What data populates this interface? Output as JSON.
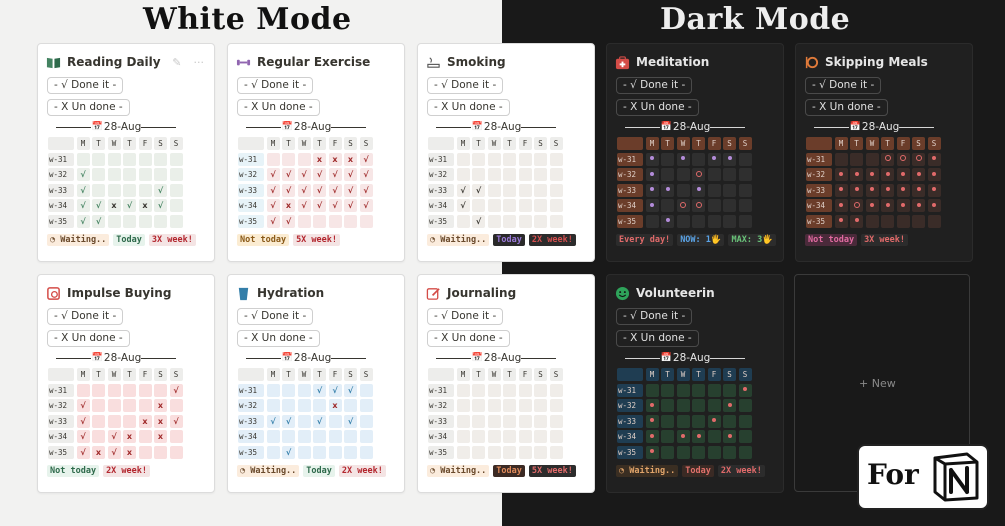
{
  "titles": {
    "white": "White Mode",
    "dark": "Dark Mode"
  },
  "common": {
    "done_label": "- √ Done it -",
    "undone_label": "- X Un done -",
    "date": "28-Aug",
    "days": [
      "M",
      "T",
      "W",
      "T",
      "F",
      "S",
      "S"
    ],
    "weeks": [
      "w-31",
      "w-32",
      "w-33",
      "w-34",
      "w-35"
    ]
  },
  "new_card": {
    "label": "+ New"
  },
  "badge": {
    "text": "For"
  },
  "cards": [
    {
      "id": "reading",
      "name": "Reading Daily",
      "theme": "light",
      "icon": "book-icon",
      "tools": true,
      "colors": {
        "head": "#ededeb",
        "cell": "#eaefe9",
        "ok": "#448361",
        "x": "#37352f"
      },
      "grid": [
        "......",
        "√.....",
        "√...√.",
        "√.x.x√.",
        "√......"
      ],
      "marks": [
        [
          ".",
          ".",
          ".",
          ".",
          ".",
          ".",
          "."
        ],
        [
          "√",
          ".",
          ".",
          ".",
          ".",
          ".",
          "."
        ],
        [
          "√",
          ".",
          ".",
          ".",
          ".",
          "√",
          "."
        ],
        [
          "√",
          "√",
          "x",
          "√",
          "x",
          "√",
          "."
        ],
        [
          "√",
          "√",
          ".",
          ".",
          ".",
          ".",
          "."
        ]
      ],
      "status": [
        {
          "text": "◔ Waiting..",
          "bg": "#fbecdd",
          "fg": "#6a4a2c"
        },
        {
          "text": "Today",
          "bg": "#e7f3ec",
          "fg": "#2e6a4b"
        },
        {
          "text": "3X week!",
          "bg": "#f4e4e4",
          "fg": "#b3262e"
        }
      ]
    },
    {
      "id": "exercise",
      "name": "Regular Exercise",
      "theme": "light",
      "icon": "dumbbell-icon",
      "tools": false,
      "colors": {
        "head": "#ededeb",
        "cell": "#f7e6e6",
        "ok": "#9f2a2a",
        "x": "#9f2a2a",
        "wk": "#e7f3f8"
      },
      "marks": [
        [
          ".",
          ".",
          ".",
          "x",
          "x",
          "x",
          "√"
        ],
        [
          "√",
          "√",
          "√",
          "√",
          "√",
          "√",
          "√"
        ],
        [
          "√",
          "√",
          "√",
          "√",
          "√",
          "√",
          "√"
        ],
        [
          "√",
          "x",
          "√",
          "√",
          "√",
          "√",
          "√"
        ],
        [
          "√",
          "√",
          ".",
          ".",
          ".",
          ".",
          "."
        ]
      ],
      "status": [
        {
          "text": "Not today",
          "bg": "#fbecd2",
          "fg": "#8a5a18"
        },
        {
          "text": "5X week!",
          "bg": "#f4e4e4",
          "fg": "#b3262e"
        }
      ]
    },
    {
      "id": "smoking",
      "name": "Smoking",
      "theme": "light",
      "icon": "no-smoking-icon",
      "tools": false,
      "colors": {
        "head": "#ededeb",
        "cell": "#f0ede9",
        "ok": "#37352f",
        "x": "#37352f"
      },
      "marks": [
        [
          ".",
          ".",
          ".",
          ".",
          ".",
          ".",
          "."
        ],
        [
          ".",
          ".",
          ".",
          ".",
          ".",
          ".",
          "."
        ],
        [
          "√",
          "√",
          ".",
          ".",
          ".",
          ".",
          "."
        ],
        [
          "√",
          ".",
          ".",
          ".",
          ".",
          ".",
          "."
        ],
        [
          ".",
          "√",
          ".",
          ".",
          ".",
          ".",
          "."
        ]
      ],
      "status": [
        {
          "text": "◔ Waiting..",
          "bg": "#fbecdd",
          "fg": "#6a4a2c"
        },
        {
          "text": "Today",
          "bg": "#2a2a2a",
          "fg": "#9a79d8"
        },
        {
          "text": "2X week!",
          "bg": "#2c2c2c",
          "fg": "#d54f4f"
        }
      ]
    },
    {
      "id": "meditation",
      "name": "Meditation",
      "theme": "dark",
      "icon": "first-aid-icon",
      "tools": false,
      "colors": {
        "head": "#6b3d2a",
        "cell": "#2f2f2f",
        "ok": "#b38cd9",
        "x": "#e06a6a",
        "wk": "#6b3d2a"
      },
      "marks": [
        [
          "dot",
          ".",
          "dot",
          ".",
          "dot",
          "dot",
          "."
        ],
        [
          "dot",
          ".",
          ".",
          "ring",
          ".",
          ".",
          "."
        ],
        [
          "dot",
          "dot",
          ".",
          "dot",
          ".",
          ".",
          "."
        ],
        [
          "dot",
          ".",
          "ring",
          "ring",
          ".",
          ".",
          "."
        ],
        [
          ".",
          "dot",
          ".",
          ".",
          ".",
          ".",
          "."
        ]
      ],
      "status": [
        {
          "text": "Every day!",
          "bg": "#2c2c2c",
          "fg": "#e06a6a"
        },
        {
          "text": "NOW: 1🖐",
          "bg": "#2c2c2c",
          "fg": "#5aa3e6"
        },
        {
          "text": "MAX: 3🖐",
          "bg": "#2c2c2c",
          "fg": "#6ac47a"
        }
      ]
    },
    {
      "id": "meals",
      "name": "Skipping Meals",
      "theme": "dark",
      "icon": "utensils-icon",
      "tools": false,
      "colors": {
        "head": "#6b3d2a",
        "cell": "#3a2c28",
        "ok": "#e06a6a",
        "x": "#e06a6a",
        "wk": "#6b3d2a"
      },
      "marks": [
        [
          ".",
          ".",
          ".",
          "ring",
          "ring",
          "ring",
          "dot"
        ],
        [
          "dot",
          "dot",
          "dot",
          "dot",
          "dot",
          "dot",
          "dot"
        ],
        [
          "dot",
          "dot",
          "dot",
          "dot",
          "dot",
          "dot",
          "dot"
        ],
        [
          "dot",
          "ring",
          "dot",
          "dot",
          "dot",
          "dot",
          "dot"
        ],
        [
          "dot",
          "dot",
          ".",
          ".",
          ".",
          ".",
          "."
        ]
      ],
      "status": [
        {
          "text": "Not today",
          "bg": "#4a2a3a",
          "fg": "#e06aa0"
        },
        {
          "text": "3X week!",
          "bg": "#2c2c2c",
          "fg": "#e06a6a"
        }
      ]
    },
    {
      "id": "impulse",
      "name": "Impulse Buying",
      "theme": "light",
      "icon": "receipt-icon",
      "tools": false,
      "colors": {
        "head": "#ededeb",
        "cell": "#f9dede",
        "ok": "#9f2a2a",
        "x": "#9f2a2a"
      },
      "marks": [
        [
          ".",
          ".",
          ".",
          ".",
          ".",
          ".",
          "√"
        ],
        [
          "√",
          ".",
          ".",
          ".",
          ".",
          "x",
          "."
        ],
        [
          "√",
          ".",
          ".",
          ".",
          "x",
          "x",
          "√"
        ],
        [
          "√",
          ".",
          "√",
          "x",
          ".",
          "x",
          "."
        ],
        [
          "√",
          "x",
          "√",
          "x",
          ".",
          ".",
          "."
        ]
      ],
      "status": [
        {
          "text": "Not today",
          "bg": "#e7f3ec",
          "fg": "#2e6a4b"
        },
        {
          "text": "2X week!",
          "bg": "#f4e4e4",
          "fg": "#b3262e"
        }
      ]
    },
    {
      "id": "hydration",
      "name": "Hydration",
      "theme": "light",
      "icon": "cup-icon",
      "tools": false,
      "colors": {
        "head": "#ededeb",
        "cell": "#e2eef8",
        "ok": "#337ea9",
        "x": "#9f2a2a",
        "wk": "#e2eef8"
      },
      "marks": [
        [
          ".",
          ".",
          ".",
          "√",
          "√",
          "√",
          "."
        ],
        [
          ".",
          ".",
          ".",
          ".",
          "x",
          ".",
          "."
        ],
        [
          "√",
          "√",
          ".",
          "√",
          ".",
          "√",
          "."
        ],
        [
          ".",
          ".",
          ".",
          ".",
          ".",
          ".",
          "."
        ],
        [
          ".",
          "√",
          ".",
          ".",
          ".",
          ".",
          "."
        ]
      ],
      "status": [
        {
          "text": "◔ Waiting..",
          "bg": "#fbecdd",
          "fg": "#6a4a2c"
        },
        {
          "text": "Today",
          "bg": "#e7f3ec",
          "fg": "#2e6a4b"
        },
        {
          "text": "2X week!",
          "bg": "#f4e4e4",
          "fg": "#b3262e"
        }
      ]
    },
    {
      "id": "journaling",
      "name": "Journaling",
      "theme": "light",
      "icon": "pencil-square-icon",
      "tools": false,
      "colors": {
        "head": "#ededeb",
        "cell": "#f0ede9",
        "ok": "#37352f",
        "x": "#37352f"
      },
      "marks": [
        [
          ".",
          ".",
          ".",
          ".",
          ".",
          ".",
          "."
        ],
        [
          ".",
          ".",
          ".",
          ".",
          ".",
          ".",
          "."
        ],
        [
          ".",
          ".",
          ".",
          ".",
          ".",
          ".",
          "."
        ],
        [
          ".",
          ".",
          ".",
          ".",
          ".",
          ".",
          "."
        ],
        [
          ".",
          ".",
          ".",
          ".",
          ".",
          ".",
          "."
        ]
      ],
      "status": [
        {
          "text": "◔ Waiting..",
          "bg": "#fbecdd",
          "fg": "#6a4a2c"
        },
        {
          "text": "Today",
          "bg": "#3b2a24",
          "fg": "#e08a5a"
        },
        {
          "text": "5X week!",
          "bg": "#2c2c2c",
          "fg": "#e06a6a"
        }
      ]
    },
    {
      "id": "volunteering",
      "name": "Volunteerin",
      "theme": "dark",
      "icon": "smiley-icon",
      "tools": false,
      "colors": {
        "head": "#1f3d52",
        "cell": "#27402f",
        "ok": "#e06a6a",
        "x": "#e06a6a",
        "wk": "#1f3d52"
      },
      "marks": [
        [
          ".",
          ".",
          ".",
          ".",
          ".",
          ".",
          "dot"
        ],
        [
          "dot",
          ".",
          ".",
          ".",
          ".",
          "dot",
          "."
        ],
        [
          "dot",
          ".",
          ".",
          ".",
          "dot",
          ".",
          "."
        ],
        [
          "dot",
          ".",
          "dot",
          "dot",
          ".",
          "dot",
          "."
        ],
        [
          "dot",
          ".",
          ".",
          ".",
          ".",
          ".",
          "."
        ]
      ],
      "status": [
        {
          "text": "◔ Waiting..",
          "bg": "#3a2e22",
          "fg": "#e0a46a"
        },
        {
          "text": "Today",
          "bg": "#3a2a24",
          "fg": "#e0706a"
        },
        {
          "text": "2X week!",
          "bg": "#2c2c2c",
          "fg": "#e06a6a"
        }
      ]
    }
  ]
}
